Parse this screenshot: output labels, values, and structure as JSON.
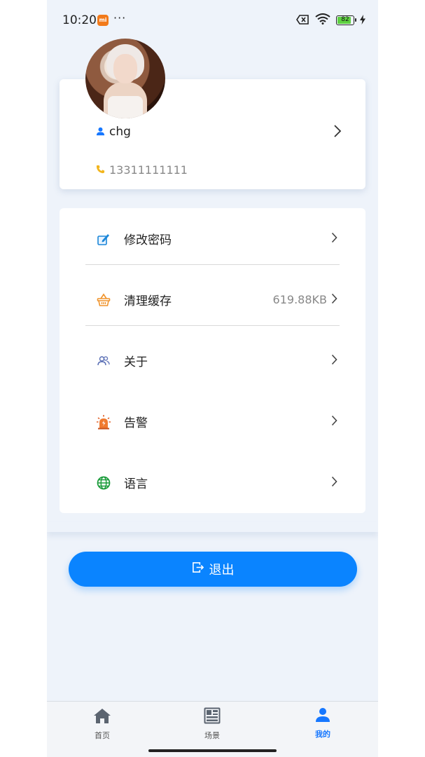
{
  "status_bar": {
    "time": "10:20",
    "dots": "···",
    "battery": "82",
    "icons": [
      "mi-app-icon",
      "sim-x-icon",
      "wifi-icon",
      "battery-icon",
      "charging-bolt-icon"
    ]
  },
  "profile": {
    "username": "chg",
    "phone": "13311111111",
    "icons": [
      "avatar",
      "user-icon",
      "phone-icon",
      "chevron-right-icon"
    ]
  },
  "menu": {
    "items": [
      {
        "label": "修改密码",
        "value": "",
        "icon": "edit-password-icon"
      },
      {
        "label": "清理缓存",
        "value": "619.88KB",
        "icon": "basket-cache-icon"
      },
      {
        "label": "关于",
        "value": "",
        "icon": "users-about-icon"
      },
      {
        "label": "告警",
        "value": "",
        "icon": "alarm-icon"
      },
      {
        "label": "语言",
        "value": "",
        "icon": "globe-icon"
      }
    ]
  },
  "logout": {
    "label": "退出",
    "icon": "logout-icon"
  },
  "bottom_nav": {
    "items": [
      {
        "label": "首页",
        "icon": "home-icon",
        "active": false
      },
      {
        "label": "场景",
        "icon": "scene-grid-icon",
        "active": false
      },
      {
        "label": "我的",
        "icon": "user-profile-icon",
        "active": true
      }
    ]
  },
  "colors": {
    "accent": "#0a84ff",
    "background": "#eef3fa",
    "active_tab": "#1677ff"
  }
}
